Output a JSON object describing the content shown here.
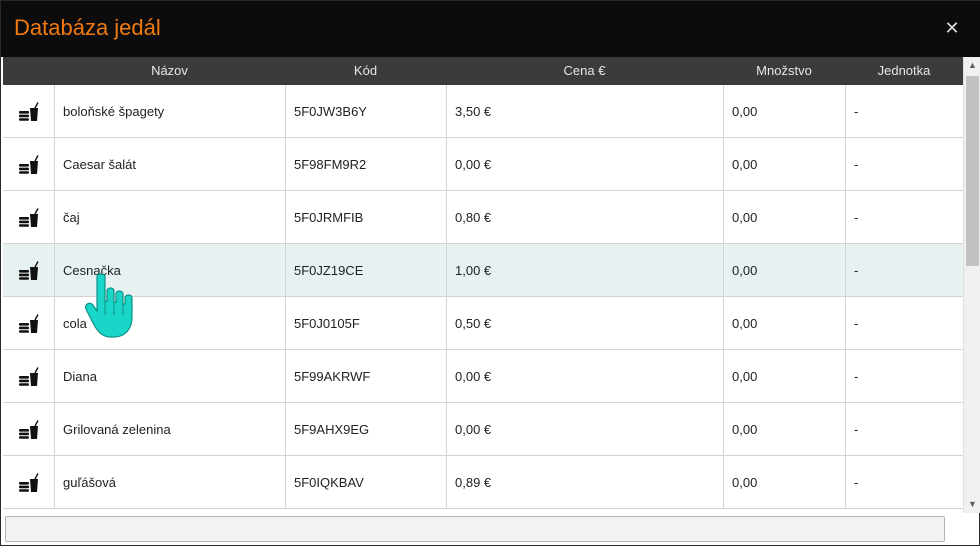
{
  "dialog": {
    "title": "Databáza jedál",
    "close_glyph": "✕"
  },
  "table": {
    "columns": [
      "",
      "Názov",
      "Kód",
      "Cena €",
      "Množstvo",
      "Jednotka"
    ],
    "rows": [
      {
        "icon": "food-drink-icon",
        "name": "boloňské špagety",
        "code": "5F0JW3B6Y",
        "price": "3,50 €",
        "qty": "0,00",
        "unit": "-"
      },
      {
        "icon": "food-drink-icon",
        "name": "Caesar šalát",
        "code": "5F98FM9R2",
        "price": "0,00 €",
        "qty": "0,00",
        "unit": "-"
      },
      {
        "icon": "food-drink-icon",
        "name": "čaj",
        "code": "5F0JRMFIB",
        "price": "0,80 €",
        "qty": "0,00",
        "unit": "-"
      },
      {
        "icon": "food-drink-icon",
        "name": "Cesnačka",
        "code": "5F0JZ19CE",
        "price": "1,00 €",
        "qty": "0,00",
        "unit": "-"
      },
      {
        "icon": "food-drink-icon",
        "name": "cola",
        "code": "5F0J0105F",
        "price": "0,50 €",
        "qty": "0,00",
        "unit": "-"
      },
      {
        "icon": "food-drink-icon",
        "name": "Diana",
        "code": "5F99AKRWF",
        "price": "0,00 €",
        "qty": "0,00",
        "unit": "-"
      },
      {
        "icon": "food-drink-icon",
        "name": "Grilovaná zelenina",
        "code": "5F9AHX9EG",
        "price": "0,00 €",
        "qty": "0,00",
        "unit": "-"
      },
      {
        "icon": "food-drink-icon",
        "name": "guľášová",
        "code": "5F0IQKBAV",
        "price": "0,89 €",
        "qty": "0,00",
        "unit": "-"
      }
    ],
    "hovered_row": "Cesnačka"
  },
  "colors": {
    "title": "#f07a12",
    "titlebar": "#0c0c0c",
    "header": "#3b3b3b",
    "hover_row": "#e7f1f1",
    "cursor": "#19d6c8"
  }
}
